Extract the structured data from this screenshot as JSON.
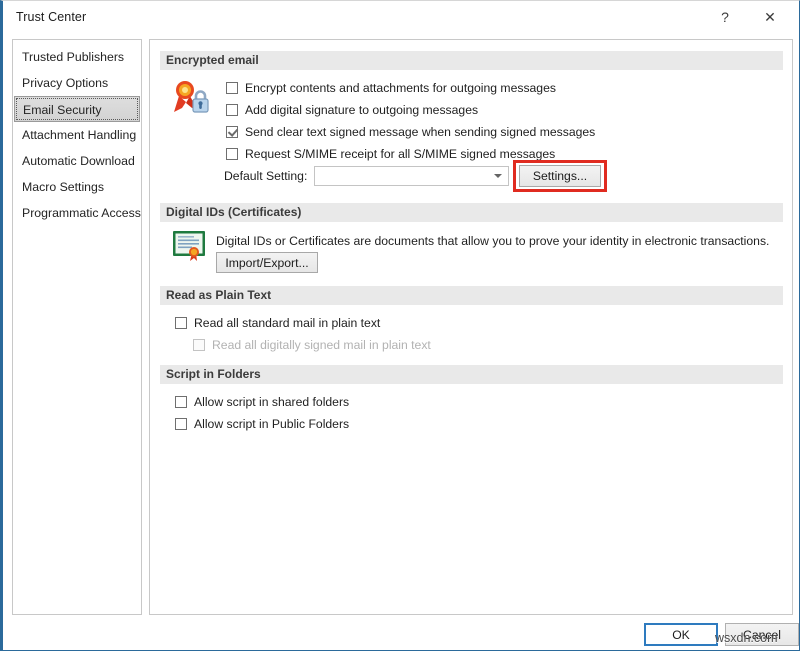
{
  "window": {
    "title": "Trust Center",
    "help_icon": "question-mark-icon",
    "close_icon": "close-icon",
    "help_glyph": "?",
    "close_glyph": "✕",
    "border_color": "#2b6a9b"
  },
  "sidebar": {
    "items": [
      {
        "label": "Trusted Publishers",
        "selected": false
      },
      {
        "label": "Privacy Options",
        "selected": false
      },
      {
        "label": "Email Security",
        "selected": true
      },
      {
        "label": "Attachment Handling",
        "selected": false
      },
      {
        "label": "Automatic Download",
        "selected": false
      },
      {
        "label": "Macro Settings",
        "selected": false
      },
      {
        "label": "Programmatic Access",
        "selected": false
      }
    ]
  },
  "sections": {
    "encrypted_email": {
      "header": "Encrypted email",
      "icon": "certificate-lock-icon",
      "checkboxes": [
        {
          "label": "Encrypt contents and attachments for outgoing messages",
          "checked": false,
          "disabled": false
        },
        {
          "label": "Add digital signature to outgoing messages",
          "checked": false,
          "disabled": false
        },
        {
          "label": "Send clear text signed message when sending signed messages",
          "checked": true,
          "disabled": false
        },
        {
          "label": "Request S/MIME receipt for all S/MIME signed messages",
          "checked": false,
          "disabled": false
        }
      ],
      "default_setting_label": "Default Setting:",
      "default_setting_value": "",
      "settings_button": "Settings...",
      "highlight_color": "#e02b20"
    },
    "digital_ids": {
      "header": "Digital IDs (Certificates)",
      "icon": "certificate-document-icon",
      "description": "Digital IDs or Certificates are documents that allow you to prove your identity in electronic transactions.",
      "import_export_button": "Import/Export..."
    },
    "read_as_plain_text": {
      "header": "Read as Plain Text",
      "checkboxes": [
        {
          "label": "Read all standard mail in plain text",
          "checked": false,
          "disabled": false
        },
        {
          "label": "Read all digitally signed mail in plain text",
          "checked": false,
          "disabled": true
        }
      ]
    },
    "script_in_folders": {
      "header": "Script in Folders",
      "checkboxes": [
        {
          "label": "Allow script in shared folders",
          "checked": false,
          "disabled": false
        },
        {
          "label": "Allow script in Public Folders",
          "checked": false,
          "disabled": false
        }
      ]
    }
  },
  "footer": {
    "ok_label": "OK",
    "cancel_label": "Cancel",
    "watermark": "wsxdn.com"
  }
}
